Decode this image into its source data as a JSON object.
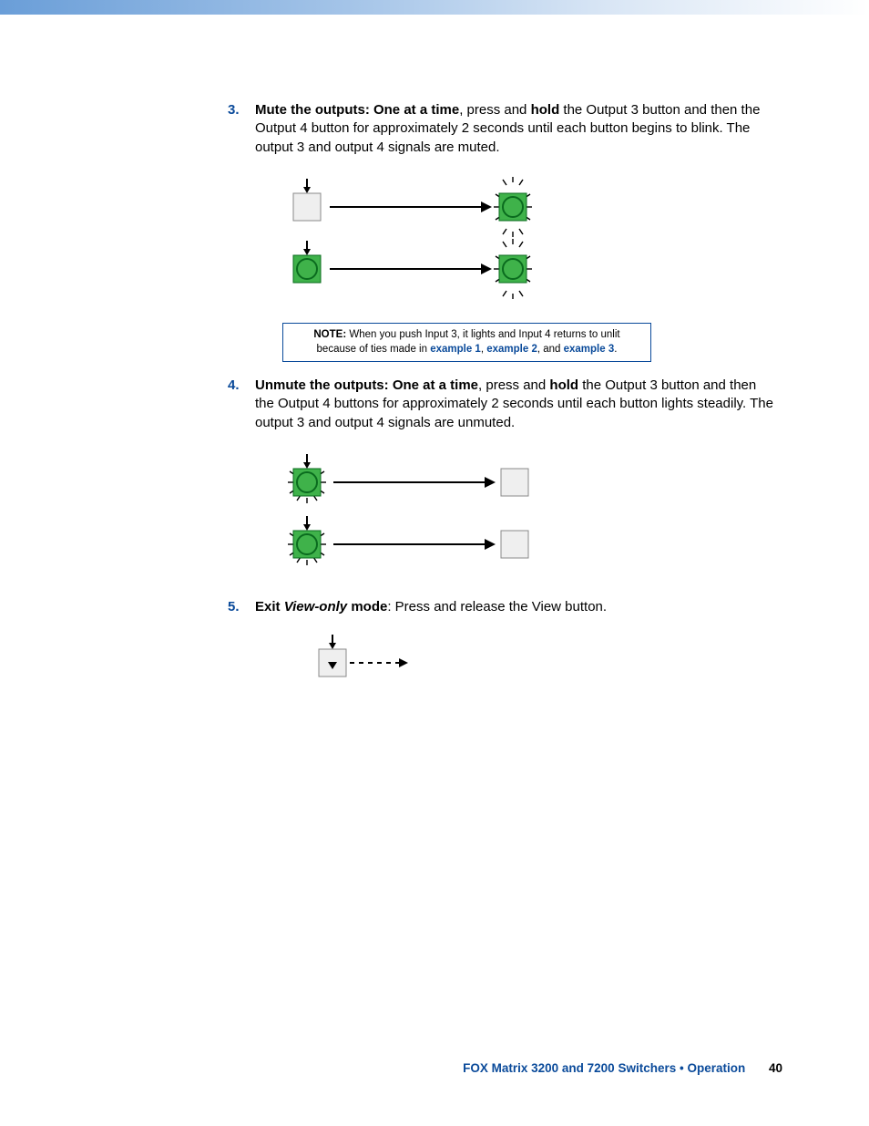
{
  "steps": {
    "s3": {
      "num": "3.",
      "lead_bold": "Mute the outputs: One at a time",
      "mid1": ", press and ",
      "hold": "hold",
      "mid2": " the Output 3 button and then the Output 4 button for approximately 2 seconds until each button begins to blink. The output 3 and output 4 signals are muted."
    },
    "s4": {
      "num": "4.",
      "lead_bold": "Unmute the outputs: One at a time",
      "mid1": ", press and ",
      "hold": "hold",
      "mid2": " the Output 3 button and then the Output 4 buttons for approximately 2 seconds until each button lights steadily. The output 3 and output 4 signals are unmuted."
    },
    "s5": {
      "num": "5.",
      "lead_bold": "Exit ",
      "mode_bi": "View-only",
      "lead_bold2": " mode",
      "rest": ": Press and release the View button."
    }
  },
  "note": {
    "label": "NOTE:",
    "t1": "  When you push Input 3, it lights and Input 4 returns to unlit because of ties made in ",
    "e1": "example 1",
    "c1": ", ",
    "e2": "example 2",
    "c2": ", and ",
    "e3": "example 3",
    "dot": "."
  },
  "footer": {
    "title": "FOX Matrix 3200 and 7200 Switchers • Operation",
    "page": "40"
  }
}
